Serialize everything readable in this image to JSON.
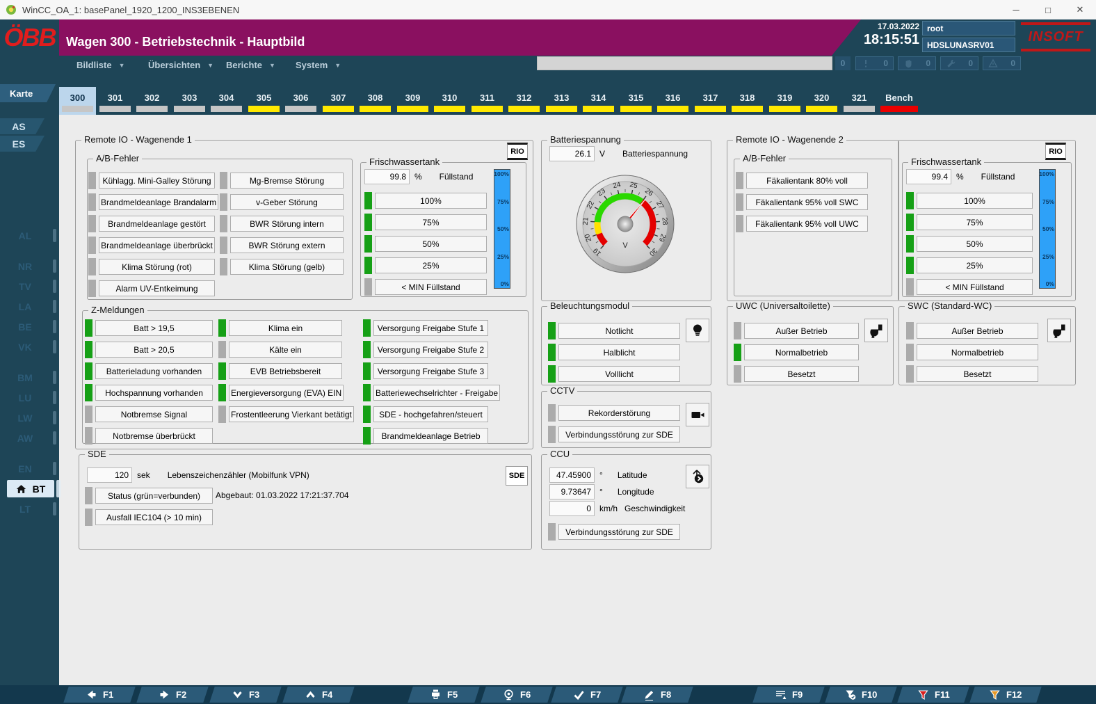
{
  "w": {
    "title": "WinCC_OA_1: basePanel_1920_1200_INS3EBENEN",
    "min": "─",
    "max": "□",
    "close": "✕"
  },
  "h": {
    "logo": "ÖBB",
    "title": "Wagen 300 - Betriebstechnik - Hauptbild",
    "date": "17.03.2022",
    "time": "18:15:51",
    "user": "root",
    "server": "HDSLUNASRV01",
    "brand": "INSOFT"
  },
  "m": {
    "items": [
      "Bildliste",
      "Übersichten",
      "Berichte",
      "System"
    ],
    "dd": "▼",
    "alarm_line": "",
    "badge0": "0",
    "counters": [
      {
        "value": "0"
      },
      {
        "value": "0"
      },
      {
        "value": "0"
      },
      {
        "value": "0"
      }
    ]
  },
  "t": {
    "karte": "Karte",
    "items": [
      {
        "label": "300",
        "u": "gray"
      },
      {
        "label": "301",
        "u": "gray"
      },
      {
        "label": "302",
        "u": "gray"
      },
      {
        "label": "303",
        "u": "gray"
      },
      {
        "label": "304",
        "u": "gray"
      },
      {
        "label": "305",
        "u": "yellow"
      },
      {
        "label": "306",
        "u": "gray"
      },
      {
        "label": "307",
        "u": "yellow"
      },
      {
        "label": "308",
        "u": "yellow"
      },
      {
        "label": "309",
        "u": "yellow"
      },
      {
        "label": "310",
        "u": "yellow"
      },
      {
        "label": "311",
        "u": "yellow"
      },
      {
        "label": "312",
        "u": "yellow"
      },
      {
        "label": "313",
        "u": "yellow"
      },
      {
        "label": "314",
        "u": "yellow"
      },
      {
        "label": "315",
        "u": "yellow"
      },
      {
        "label": "316",
        "u": "yellow"
      },
      {
        "label": "317",
        "u": "yellow"
      },
      {
        "label": "318",
        "u": "yellow"
      },
      {
        "label": "319",
        "u": "yellow"
      },
      {
        "label": "320",
        "u": "yellow"
      },
      {
        "label": "321",
        "u": "gray"
      },
      {
        "label": "Bench",
        "u": "red"
      }
    ]
  },
  "sb": {
    "as": "AS",
    "es": "ES",
    "items": [
      "AL",
      "NR",
      "TV",
      "LA",
      "BE",
      "VK",
      "BM",
      "LU",
      "LW",
      "AW",
      "EN"
    ],
    "bt": "BT",
    "lt": "LT"
  },
  "r1": {
    "title": "Remote IO - Wagenende 1",
    "rio": "RIO",
    "ab": {
      "title": "A/B-Fehler",
      "col1": [
        {
          "label": "Kühlagg. Mini-Galley Störung",
          "state": "gray"
        },
        {
          "label": "Brandmeldeanlage Brandalarm",
          "state": "gray"
        },
        {
          "label": "Brandmeldeanlage gestört",
          "state": "gray"
        },
        {
          "label": "Brandmeldeanlage überbrückt",
          "state": "gray"
        },
        {
          "label": "Klima Störung (rot)",
          "state": "gray"
        },
        {
          "label": "Alarm UV-Entkeimung",
          "state": "gray"
        }
      ],
      "col2": [
        {
          "label": "Mg-Bremse Störung",
          "state": "gray"
        },
        {
          "label": "v-Geber Störung",
          "state": "gray"
        },
        {
          "label": "BWR Störung intern",
          "state": "gray"
        },
        {
          "label": "BWR Störung extern",
          "state": "gray"
        },
        {
          "label": "Klima Störung (gelb)",
          "state": "gray"
        }
      ]
    },
    "tank": {
      "title": "Frischwassertank",
      "value": "99.8",
      "unit": "%",
      "label": "Füllstand",
      "levels": [
        {
          "label": "100%",
          "state": "green"
        },
        {
          "label": "75%",
          "state": "green"
        },
        {
          "label": "50%",
          "state": "green"
        },
        {
          "label": "25%",
          "state": "green"
        },
        {
          "label": "< MIN Füllstand",
          "state": "gray"
        }
      ],
      "scale": [
        "100%",
        "75%",
        "50%",
        "25%",
        "0%"
      ]
    },
    "z": {
      "title": "Z-Meldungen",
      "col1": [
        {
          "label": "Batt > 19,5",
          "state": "green"
        },
        {
          "label": "Batt > 20,5",
          "state": "green"
        },
        {
          "label": "Batterieladung vorhanden",
          "state": "green"
        },
        {
          "label": "Hochspannung vorhanden",
          "state": "green"
        },
        {
          "label": "Notbremse Signal",
          "state": "gray"
        },
        {
          "label": "Notbremse überbrückt",
          "state": "gray"
        }
      ],
      "col2": [
        {
          "label": "Klima ein",
          "state": "green"
        },
        {
          "label": "Kälte ein",
          "state": "gray"
        },
        {
          "label": "EVB Betriebsbereit",
          "state": "green"
        },
        {
          "label": "Energieversorgung (EVA) EIN",
          "state": "green"
        },
        {
          "label": "Frostentleerung Vierkant betätigt",
          "state": "gray"
        }
      ],
      "col3": [
        {
          "label": "Versorgung Freigabe Stufe 1",
          "state": "green"
        },
        {
          "label": "Versorgung Freigabe Stufe 2",
          "state": "green"
        },
        {
          "label": "Versorgung Freigabe Stufe 3",
          "state": "green"
        },
        {
          "label": "Batteriewechselrichter - Freigabe",
          "state": "green"
        },
        {
          "label": "SDE - hochgefahren/steuert",
          "state": "green"
        },
        {
          "label": "Brandmeldeanlage Betrieb",
          "state": "green"
        }
      ]
    }
  },
  "sde": {
    "title": "SDE",
    "btn": "SDE",
    "value": "120",
    "unit": "sek",
    "label": "Lebenszeichenzähler (Mobilfunk VPN)",
    "status_text": "Abgebaut: 01.03.2022 17:21:37.704",
    "items": [
      {
        "label": "Status (grün=verbunden)",
        "state": "gray"
      },
      {
        "label": "Ausfall IEC104 (> 10 min)",
        "state": "gray"
      }
    ]
  },
  "b": {
    "title": "Batteriespannung",
    "value": "26.1",
    "unit": "V",
    "label": "Batteriespannung",
    "gauge_unit": "V",
    "ticks": [
      "19",
      "20",
      "21",
      "22",
      "23",
      "24",
      "25",
      "26",
      "27",
      "28",
      "29",
      "30"
    ]
  },
  "lg": {
    "title": "Beleuchtungsmodul",
    "items": [
      {
        "label": "Notlicht",
        "state": "green"
      },
      {
        "label": "Halblicht",
        "state": "green"
      },
      {
        "label": "Volllicht",
        "state": "green"
      }
    ]
  },
  "cv": {
    "title": "CCTV",
    "items": [
      {
        "label": "Rekorderstörung",
        "state": "gray"
      },
      {
        "label": "Verbindungsstörung zur SDE",
        "state": "gray"
      }
    ]
  },
  "cu": {
    "title": "CCU",
    "fields": [
      {
        "value": "47.45900",
        "unit": "°",
        "label": "Latitude"
      },
      {
        "value": "9.73647",
        "unit": "°",
        "label": "Longitude"
      },
      {
        "value": "0",
        "unit": "km/h",
        "label": "Geschwindigkeit"
      }
    ],
    "items": [
      {
        "label": "Verbindungsstörung zur SDE",
        "state": "gray"
      }
    ]
  },
  "r2": {
    "title": "Remote IO - Wagenende 2",
    "rio": "RIO",
    "ab": {
      "title": "A/B-Fehler",
      "col1": [
        {
          "label": "Fäkalientank 80% voll",
          "state": "gray"
        },
        {
          "label": "Fäkalientank 95% voll SWC",
          "state": "gray"
        },
        {
          "label": "Fäkalientank 95% voll UWC",
          "state": "gray"
        }
      ]
    }
  },
  "t2": {
    "title": "Frischwassertank",
    "value": "99.4",
    "unit": "%",
    "label": "Füllstand",
    "levels": [
      {
        "label": "100%",
        "state": "green"
      },
      {
        "label": "75%",
        "state": "green"
      },
      {
        "label": "50%",
        "state": "green"
      },
      {
        "label": "25%",
        "state": "green"
      },
      {
        "label": "< MIN Füllstand",
        "state": "gray"
      }
    ],
    "scale": [
      "100%",
      "75%",
      "50%",
      "25%",
      "0%"
    ]
  },
  "uwc": {
    "title": "UWC (Universaltoilette)",
    "items": [
      {
        "label": "Außer Betrieb",
        "state": "gray"
      },
      {
        "label": "Normalbetrieb",
        "state": "green"
      },
      {
        "label": "Besetzt",
        "state": "gray"
      }
    ]
  },
  "swc": {
    "title": "SWC (Standard-WC)",
    "items": [
      {
        "label": "Außer Betrieb",
        "state": "gray"
      },
      {
        "label": "Normalbetrieb",
        "state": "gray"
      },
      {
        "label": "Besetzt",
        "state": "gray"
      }
    ]
  },
  "fk": [
    {
      "label": "F1"
    },
    {
      "label": "F2"
    },
    {
      "label": "F3"
    },
    {
      "label": "F4"
    },
    {
      "label": "F5"
    },
    {
      "label": "F6"
    },
    {
      "label": "F7"
    },
    {
      "label": "F8"
    },
    {
      "label": "F9"
    },
    {
      "label": "F10"
    },
    {
      "label": "F11"
    },
    {
      "label": "F12"
    }
  ]
}
